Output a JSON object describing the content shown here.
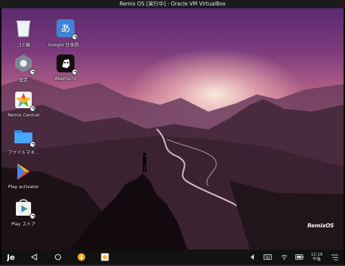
{
  "window": {
    "title": "Remix OS [実行中] - Oracle VM VirtualBox"
  },
  "desktop": {
    "icons": [
      {
        "label": "ゴミ箱",
        "icon": "trash-icon"
      },
      {
        "label": "Google 日本語...",
        "icon": "google-japanese-input-icon"
      },
      {
        "label": "設定",
        "icon": "settings-icon"
      },
      {
        "label": "AbemaTV",
        "icon": "abematv-icon"
      },
      {
        "label": "Remix Central",
        "icon": "remix-central-icon"
      },
      {
        "label": "ファイルマネ...",
        "icon": "folder-icon"
      },
      {
        "label": "Play activator",
        "icon": "play-activator-icon"
      },
      {
        "label": "Play ストア",
        "icon": "play-store-icon"
      }
    ],
    "watermark": "RemixOS"
  },
  "taskbar": {
    "start_icon": "remix-start-icon",
    "nav": [
      "back-icon",
      "home-icon",
      "recents-icon"
    ],
    "clock_time": "12:16",
    "clock_period": "午後"
  }
}
